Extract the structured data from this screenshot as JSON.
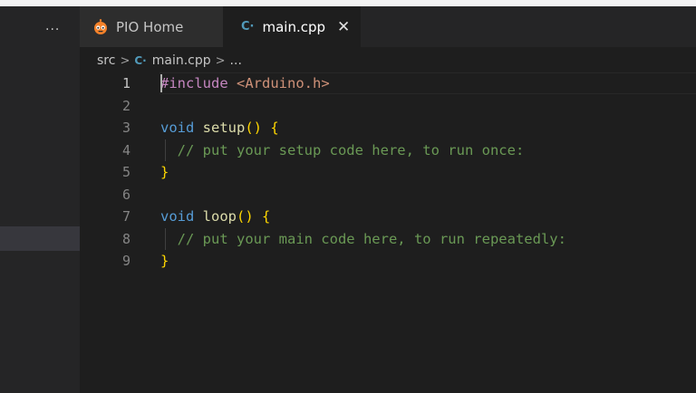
{
  "left_panel": {
    "more_label": "···"
  },
  "tabs": [
    {
      "label": "PIO Home",
      "icon": "platformio-alien-icon",
      "active": false
    },
    {
      "label": "main.cpp",
      "icon": "cpp-file-icon",
      "active": true,
      "close": "✕"
    }
  ],
  "cpp_icon_glyph": "C·",
  "breadcrumb": {
    "folder": "src",
    "separator": ">",
    "file": "main.cpp",
    "more": "..."
  },
  "editor": {
    "line_numbers": [
      "1",
      "2",
      "3",
      "4",
      "5",
      "6",
      "7",
      "8",
      "9"
    ],
    "active_line": "1",
    "lines": {
      "l1_directive": "#include",
      "l1_header": "<Arduino.h>",
      "l3_type": "void",
      "l3_name": "setup",
      "l3_parens": "()",
      "l3_brace": "{",
      "l4_comment": "// put your setup code here, to run once:",
      "l5_brace": "}",
      "l7_type": "void",
      "l7_name": "loop",
      "l7_parens": "()",
      "l7_brace": "{",
      "l8_comment": "// put your main code here, to run repeatedly:",
      "l9_brace": "}"
    }
  },
  "colors": {
    "background": "#1e1e1e",
    "preprocessor": "#c586c0",
    "string": "#ce9178",
    "keyword": "#569cd6",
    "function": "#dcdcaa",
    "bracket": "#ffd700",
    "comment": "#6a9955",
    "cpp_icon": "#519aba",
    "pio_icon": "#f5822a"
  }
}
